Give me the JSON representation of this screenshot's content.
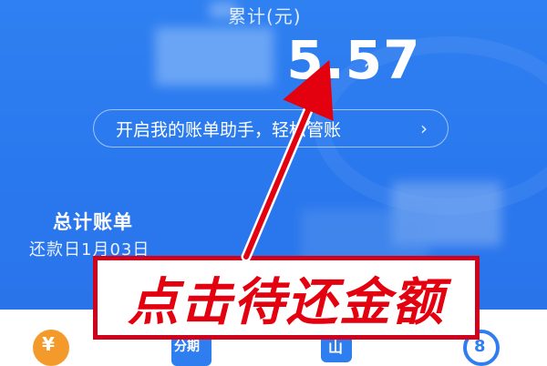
{
  "header": {
    "cumulative_label": "累计(元)",
    "amount": "5.57",
    "chevron": "›"
  },
  "assistant_pill": {
    "label": "开启我的账单助手，轻松管账",
    "chevron": "›"
  },
  "bill": {
    "title": "总计账单",
    "due_date": "还款日1月03日"
  },
  "annotation": {
    "callout_text": "点击待还金额",
    "color": "#e3000f"
  },
  "tabs": [
    {
      "icon": "orange-circle-icon",
      "glyph": "¥"
    },
    {
      "icon": "installment-icon",
      "glyph": "分期"
    },
    {
      "icon": "bar-chart-icon",
      "glyph": "山"
    },
    {
      "icon": "ring-icon",
      "glyph": "8"
    }
  ],
  "colors": {
    "primary_blue": "#2a78ee",
    "annotation_red": "#d0021b"
  }
}
